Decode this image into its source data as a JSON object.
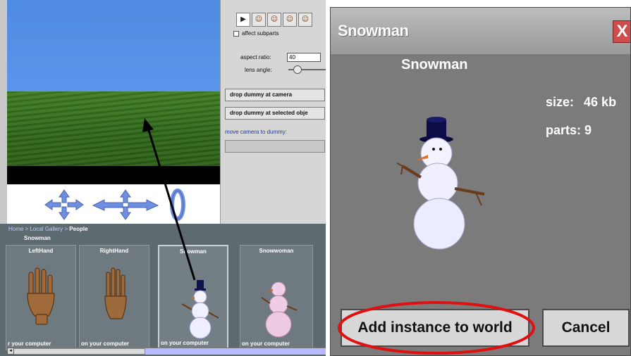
{
  "editor": {
    "toolbar_icons": [
      "pointer-icon",
      "move-icon",
      "turn-icon",
      "rotate-icon",
      "resize-icon"
    ],
    "affect_subparts_label": "affect subparts",
    "aspect_ratio_label": "aspect ratio:",
    "aspect_ratio_value": "40",
    "lens_angle_label": "lens angle:",
    "buttons": {
      "drop_camera": "drop dummy at camera",
      "drop_selected": "drop dummy at selected obje",
      "move_to_dummy": "move camera to dummy:"
    }
  },
  "gallery": {
    "breadcrumb": {
      "home": "Home",
      "sep1": " > ",
      "local": "Local Gallery",
      "sep2": " > ",
      "people": "People"
    },
    "title": "Snowman",
    "tiles": [
      {
        "name": "LeftHand",
        "footer": "r your computer"
      },
      {
        "name": "RightHand",
        "footer": "on your computer"
      },
      {
        "name": "Snowman",
        "footer": "on your computer"
      },
      {
        "name": "Snowwoman",
        "footer": "on your computer"
      }
    ]
  },
  "dialog": {
    "window_title": "Snowman",
    "close_label": "X",
    "heading": "Snowman",
    "size_label": "size:",
    "size_value": "46 kb",
    "parts_label": "parts:",
    "parts_value": "9",
    "add_button": "Add instance to world",
    "cancel_button": "Cancel"
  },
  "colors": {
    "highlight_ring": "#e01010",
    "dialog_bg": "#7b7b7b",
    "sky": "#4f8be0",
    "ground": "#2e6618"
  }
}
